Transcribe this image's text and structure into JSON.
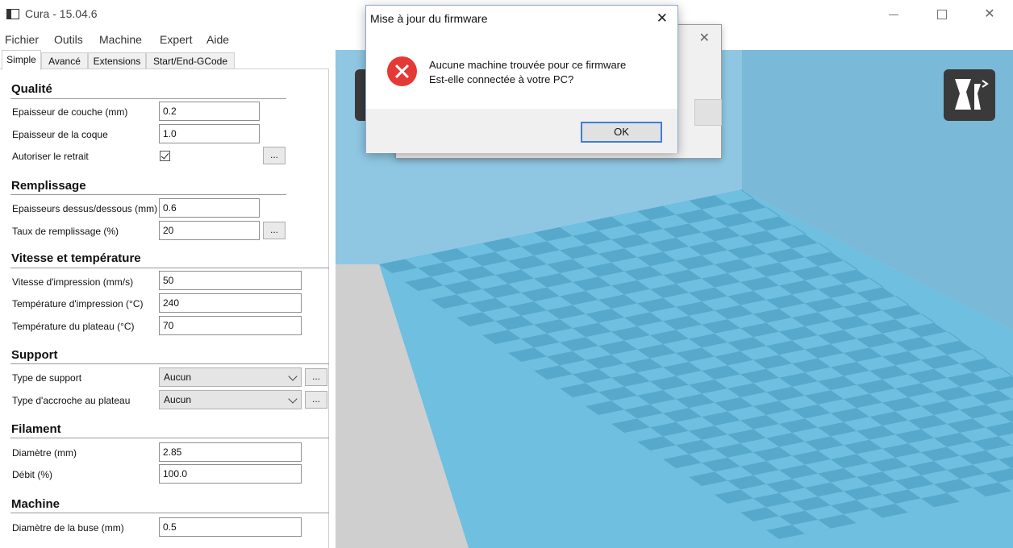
{
  "window": {
    "title": "Cura - 15.04.6"
  },
  "menu": [
    "Fichier",
    "Outils",
    "Machine",
    "Expert",
    "Aide"
  ],
  "tabs": [
    "Simple",
    "Avancé",
    "Extensions",
    "Start/End-GCode"
  ],
  "sections": {
    "qualite": {
      "title": "Qualité",
      "layer_height": {
        "label": "Epaisseur de couche (mm)",
        "value": "0.2"
      },
      "shell": {
        "label": "Epaisseur de la coque",
        "value": "1.0"
      },
      "retraction": {
        "label": "Autoriser le retrait",
        "checked": true
      }
    },
    "remplissage": {
      "title": "Remplissage",
      "top_bottom": {
        "label": "Epaisseurs dessus/dessous (mm)",
        "value": "0.6"
      },
      "fill": {
        "label": "Taux de remplissage (%)",
        "value": "20"
      }
    },
    "vitesse": {
      "title": "Vitesse et température",
      "speed": {
        "label": "Vitesse d'impression (mm/s)",
        "value": "50"
      },
      "temp": {
        "label": "Température d'impression (°C)",
        "value": "240"
      },
      "bed": {
        "label": "Température du plateau (°C)",
        "value": "70"
      }
    },
    "support": {
      "title": "Support",
      "type": {
        "label": "Type de support",
        "value": "Aucun"
      },
      "adhesion": {
        "label": "Type d'accroche au plateau",
        "value": "Aucun"
      }
    },
    "filament": {
      "title": "Filament",
      "diameter": {
        "label": "Diamètre (mm)",
        "value": "2.85"
      },
      "flow": {
        "label": "Débit (%)",
        "value": "100.0"
      }
    },
    "machine": {
      "title": "Machine",
      "nozzle": {
        "label": "Diamètre de la buse (mm)",
        "value": "0.5"
      }
    }
  },
  "dots_label": "...",
  "dialog": {
    "title": "Mise à jour du firmware",
    "line1": "Aucune machine trouvée pour ce firmware",
    "line2": "Est-elle connectée à votre PC?",
    "ok": "OK"
  },
  "colors": {
    "floor_light": "#6ebfe0",
    "floor_dark": "#57a9cb",
    "wall": "#8fc7e2",
    "wall_dark": "#7bb9d8"
  }
}
